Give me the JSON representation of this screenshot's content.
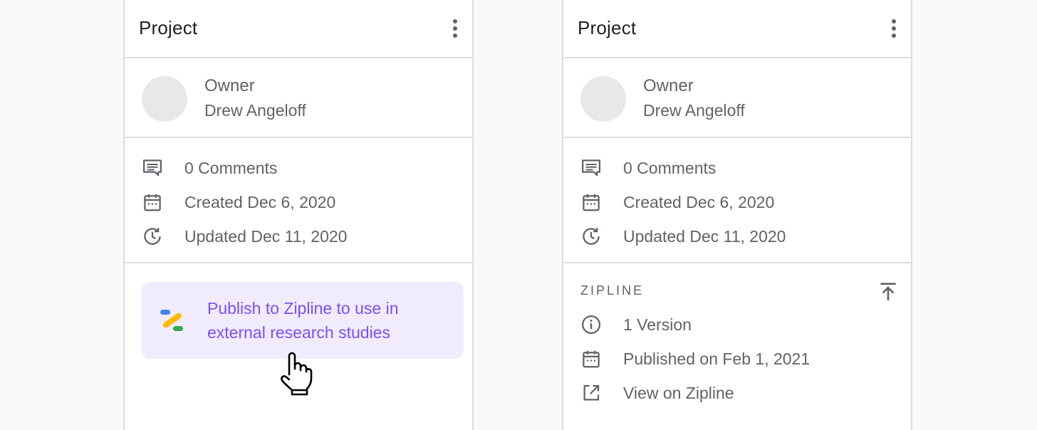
{
  "left_panel": {
    "title": "Project",
    "menu_icon": "more-vert-icon",
    "owner": {
      "role": "Owner",
      "name": "Drew Angeloff"
    },
    "meta": [
      {
        "icon": "comment-icon",
        "text": "0 Comments"
      },
      {
        "icon": "calendar-icon",
        "text": "Created Dec 6, 2020"
      },
      {
        "icon": "history-icon",
        "text": "Updated Dec 11, 2020"
      }
    ],
    "promo": {
      "icon": "zipline-logo-icon",
      "text": "Publish to Zipline to use in external research studies"
    }
  },
  "right_panel": {
    "title": "Project",
    "menu_icon": "more-vert-icon",
    "owner": {
      "role": "Owner",
      "name": "Drew Angeloff"
    },
    "meta": [
      {
        "icon": "comment-icon",
        "text": "0 Comments"
      },
      {
        "icon": "calendar-icon",
        "text": "Created Dec 6, 2020"
      },
      {
        "icon": "history-icon",
        "text": "Updated Dec 11, 2020"
      }
    ],
    "zipline": {
      "heading": "ZIPLINE",
      "action_icon": "publish-upload-icon",
      "items": [
        {
          "icon": "info-icon",
          "text": "1 Version"
        },
        {
          "icon": "calendar-icon",
          "text": "Published on Feb 1, 2021"
        },
        {
          "icon": "open-in-new-icon",
          "text": "View on Zipline"
        }
      ]
    }
  },
  "colors": {
    "background": "#f8f9fa",
    "panel": "#ffffff",
    "divider": "#dadce0",
    "text_primary": "#202124",
    "text_secondary": "#5f6368",
    "promo_bg": "#f1ecfd",
    "promo_text": "#7c4dff"
  }
}
